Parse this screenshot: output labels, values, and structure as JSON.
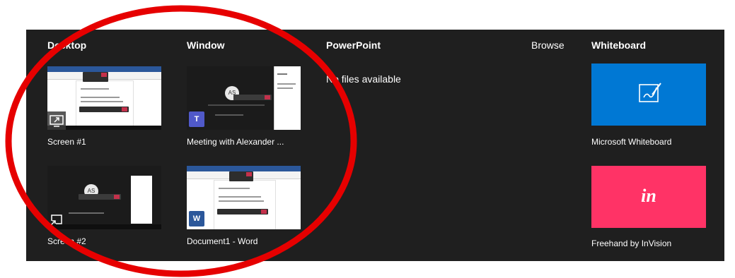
{
  "columns": {
    "desktop": "Desktop",
    "window": "Window",
    "powerpoint": "PowerPoint",
    "browse": "Browse",
    "whiteboard": "Whiteboard"
  },
  "powerpoint_empty": "No files available",
  "desktop_tiles": [
    {
      "label": "Screen #1"
    },
    {
      "label": "Screen #2"
    }
  ],
  "window_tiles": [
    {
      "label": "Meeting with Alexander ...",
      "app_badge": "T",
      "avatar": "AS"
    },
    {
      "label": "Document1 - Word",
      "app_badge": "W"
    }
  ],
  "whiteboard_tiles": [
    {
      "label": "Microsoft Whiteboard",
      "icon": "whiteboard-pen-icon",
      "color": "#0078d4"
    },
    {
      "label": "Freehand by InVision",
      "icon_text": "in",
      "color": "#ff3366"
    }
  ],
  "colors": {
    "panel_bg": "#1f1f1f",
    "annotation": "#e60000",
    "teams": "#5059c9",
    "word": "#2b579a"
  }
}
